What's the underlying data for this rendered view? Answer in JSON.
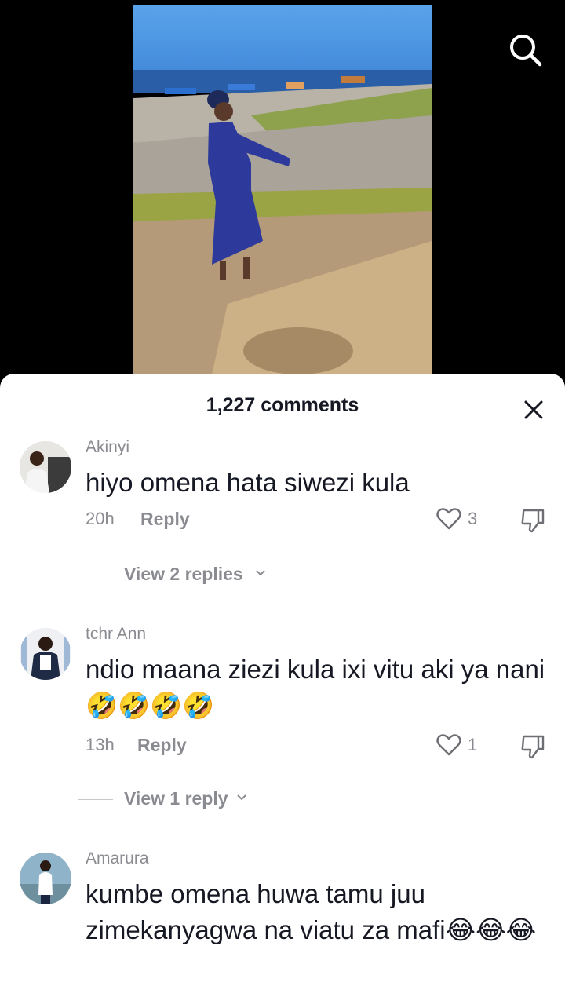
{
  "header": {
    "search_icon": "search-icon"
  },
  "sheet": {
    "title": "1,227 comments",
    "close_icon": "close-icon"
  },
  "comments": [
    {
      "username": "Akinyi",
      "text": "hiyo omena hata siwezi kula",
      "time": "20h",
      "reply_label": "Reply",
      "likes": "3",
      "view_replies": "View 2 replies"
    },
    {
      "username": "tchr Ann",
      "text": "ndio maana ziezi kula ixi vitu aki ya nani🤣🤣🤣🤣",
      "time": "13h",
      "reply_label": "Reply",
      "likes": "1",
      "view_replies": "View 1 reply"
    },
    {
      "username": "Amarura",
      "text": "kumbe omena huwa tamu juu zimekanyagwa na viatu za mafi😂😂😂"
    }
  ],
  "colors": {
    "sheet_bg": "#ffffff",
    "text": "#161823",
    "muted": "#8a8b91",
    "video_bg": "#000000"
  }
}
